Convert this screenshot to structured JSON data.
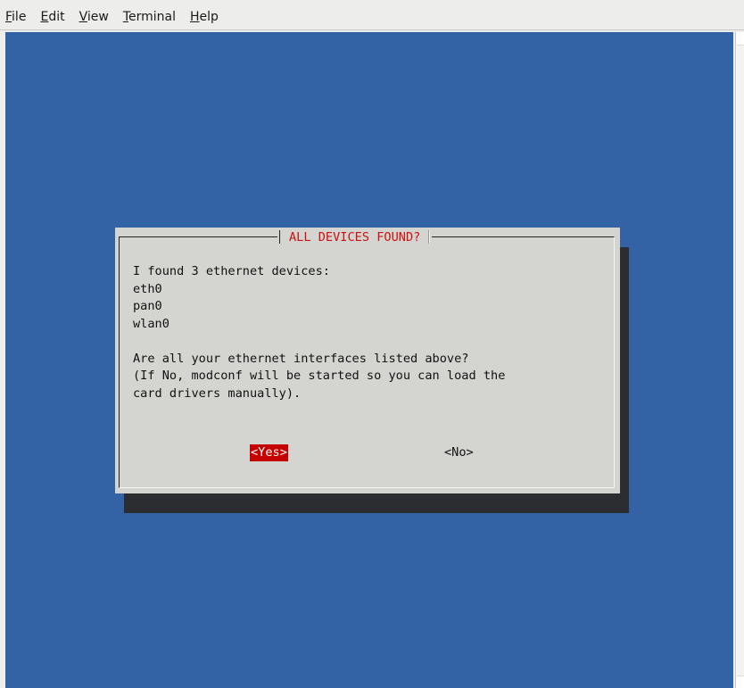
{
  "menubar": {
    "items": [
      {
        "mnemonic": "F",
        "rest": "ile"
      },
      {
        "mnemonic": "E",
        "rest": "dit"
      },
      {
        "mnemonic": "V",
        "rest": "iew"
      },
      {
        "mnemonic": "T",
        "rest": "erminal"
      },
      {
        "mnemonic": "H",
        "rest": "elp"
      }
    ]
  },
  "dialog": {
    "title": "ALL DEVICES FOUND?",
    "lines": [
      "I found 3 ethernet devices:",
      "eth0",
      "pan0",
      "wlan0",
      "",
      "Are all your ethernet interfaces listed above?",
      "(If No, modconf will be started so you can load the",
      "card drivers manually)."
    ],
    "yes_label": "<Yes>",
    "no_label": "<No>"
  },
  "colors": {
    "terminal_bg": "#3363a4",
    "dialog_bg": "#d4d4d0",
    "title_text": "#cc1111",
    "selected_button_bg": "#c40000"
  }
}
